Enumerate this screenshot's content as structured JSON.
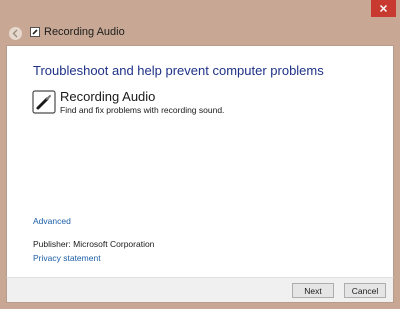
{
  "window": {
    "title": "Recording Audio"
  },
  "main": {
    "heading": "Troubleshoot and help prevent computer problems",
    "item": {
      "title": "Recording Audio",
      "description": "Find and fix problems with recording sound."
    },
    "advanced_link": "Advanced",
    "publisher": "Publisher:  Microsoft Corporation",
    "privacy_link": "Privacy statement"
  },
  "footer": {
    "next_label": "Next",
    "cancel_label": "Cancel"
  },
  "colors": {
    "frame": "#c8a894",
    "heading": "#1e3287",
    "link": "#1c5ea8",
    "close": "#c8392f"
  }
}
